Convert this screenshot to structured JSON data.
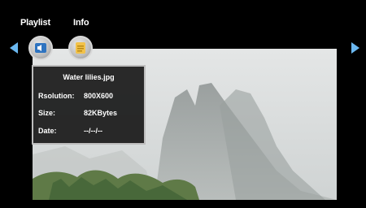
{
  "tabs": {
    "playlist_label": "Playlist",
    "info_label": "Info"
  },
  "info_panel": {
    "filename": "Water lilies.jpg",
    "resolution_label": "Rsolution:",
    "resolution_value": "800X600",
    "size_label": "Size:",
    "size_value": "82KBytes",
    "date_label": "Date:",
    "date_value": "--/--/--"
  },
  "icons": {
    "prev": "triangle-left-icon",
    "next": "triangle-right-icon",
    "playlist": "speaker-icon",
    "info": "document-icon"
  },
  "colors": {
    "background": "#000000",
    "arrow": "#6bb8f0",
    "panel": "#0a0a0a"
  }
}
